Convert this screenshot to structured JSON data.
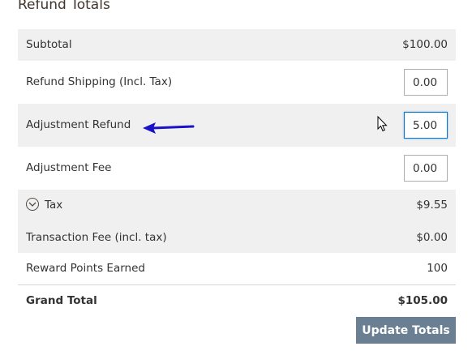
{
  "section": {
    "title": "Refund Totals"
  },
  "rows": {
    "subtotal": {
      "label": "Subtotal",
      "value": "$100.00"
    },
    "refund_shipping": {
      "label": "Refund Shipping (Incl. Tax)",
      "value": "0.00"
    },
    "adjustment_refund": {
      "label": "Adjustment Refund",
      "value": "5.00"
    },
    "adjustment_fee": {
      "label": "Adjustment Fee",
      "value": "0.00"
    },
    "tax": {
      "label": "Tax",
      "value": "$9.55"
    },
    "transaction_fee": {
      "label": "Transaction Fee (incl. tax)",
      "value": "$0.00"
    },
    "reward_points": {
      "label": "Reward Points Earned",
      "value": "100"
    },
    "grand_total": {
      "label": "Grand Total",
      "value": "$105.00"
    }
  },
  "actions": {
    "update_totals": "Update Totals"
  },
  "icons": {
    "tax_toggle": "chevron-down-circle-icon",
    "annotation": "arrow-left-icon",
    "pointer": "mouse-cursor-icon"
  },
  "colors": {
    "row_alt": "#f0f0f0",
    "button": "#6b7f92",
    "focus_border": "#007bdb",
    "annotation_arrow": "#1a12c8"
  }
}
